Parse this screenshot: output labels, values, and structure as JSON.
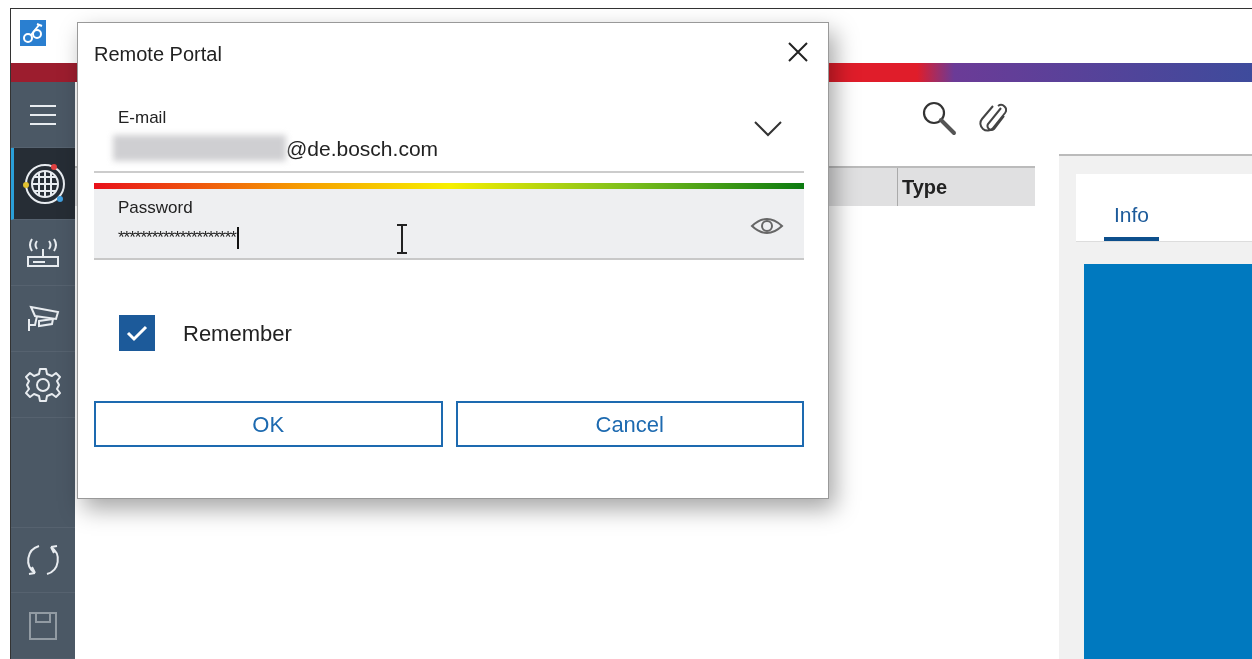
{
  "app": {
    "sidebar": {
      "items": [
        {
          "kind": "menu",
          "selected": false,
          "disabled": false
        },
        {
          "kind": "globe",
          "selected": true,
          "disabled": false
        },
        {
          "kind": "router",
          "selected": false,
          "disabled": false
        },
        {
          "kind": "camera",
          "selected": false,
          "disabled": false
        },
        {
          "kind": "settings",
          "selected": false,
          "disabled": false
        },
        {
          "kind": "refresh",
          "selected": false,
          "disabled": false
        },
        {
          "kind": "save",
          "selected": false,
          "disabled": true
        }
      ]
    },
    "table": {
      "columns": [
        "Type"
      ]
    },
    "details": {
      "tabs": [
        {
          "label": "Info",
          "selected": true
        }
      ]
    }
  },
  "dialog": {
    "title": "Remote Portal",
    "email": {
      "label": "E-mail",
      "value": "@de.bosch.com",
      "redacted": true
    },
    "password": {
      "label": "Password",
      "value": "*********************",
      "level": 1
    },
    "remember": {
      "label": "Remember",
      "checked": true
    },
    "buttons": [
      "OK",
      "Cancel"
    ]
  }
}
